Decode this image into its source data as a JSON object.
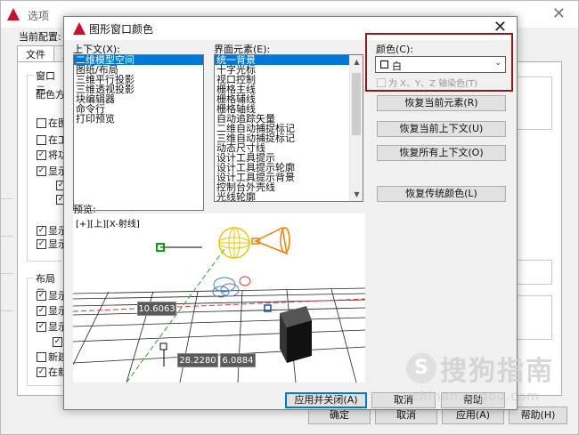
{
  "background_window": {
    "title": "选项",
    "current_profile_label": "当前配置:",
    "tabs": [
      "文件",
      "显"
    ],
    "group1_label": "窗口元",
    "color_scheme_label": "配色方",
    "checkboxes_a": [
      {
        "label": "在图",
        "checked": false
      },
      {
        "label": "在工",
        "checked": false
      },
      {
        "label": "将功",
        "checked": true
      },
      {
        "label": "显示",
        "checked": true
      }
    ],
    "checkboxes_a_sub": [
      {
        "checked": true
      },
      {
        "checked": true
      }
    ],
    "checkboxes_b": [
      {
        "label": "显示",
        "checked": true
      },
      {
        "label": "显示",
        "checked": true
      }
    ],
    "group2_label": "布局元",
    "checkboxes_c": [
      {
        "label": "显示",
        "checked": true
      },
      {
        "label": "显示",
        "checked": true
      },
      {
        "label": "显示",
        "checked": true
      }
    ],
    "checkboxes_c_sub": [
      {
        "checked": true
      }
    ],
    "checkboxes_d": [
      {
        "label": "新建",
        "checked": false
      },
      {
        "label": "在新",
        "checked": true
      }
    ],
    "footer_buttons": [
      "确定",
      "取消",
      "应用(A)",
      "帮助(H)"
    ]
  },
  "dialog": {
    "title": "图形窗口颜色",
    "context_label": "上下文(X):",
    "context_items": [
      "二维模型空间",
      "图纸/布局",
      "三维平行投影",
      "三维透视投影",
      "块编辑器",
      "命令行",
      "打印预览"
    ],
    "context_selected": 0,
    "element_label": "界面元素(E):",
    "element_items": [
      "统一背景",
      "十字光标",
      "视口控制",
      "栅格主线",
      "栅格辅线",
      "栅格轴线",
      "自动追踪矢量",
      "二维自动捕捉标记",
      "三维自动捕捉标记",
      "动态尺寸线",
      "设计工具提示",
      "设计工具提示轮廓",
      "设计工具提示背景",
      "控制台外壳线",
      "光线轮廓"
    ],
    "element_selected": 0,
    "color_label": "颜色(C):",
    "color_value": "白",
    "tint_label": "为 X、Y、Z 轴染色(T)",
    "tint_checked": false,
    "buttons": {
      "restore_element": "恢复当前元素(R)",
      "restore_context": "恢复当前上下文(U)",
      "restore_all": "恢复所有上下文(O)",
      "restore_classic": "恢复传统颜色(L)"
    },
    "preview_label": "预览:",
    "preview": {
      "view_label": "[+][上][X-射线]",
      "dimensions": [
        "10.6063",
        "28.2280",
        "6.0884"
      ]
    },
    "footer": {
      "apply_close": "应用并关闭(A)",
      "cancel": "取消",
      "help": "帮助"
    }
  },
  "watermark": {
    "logo_glyph": "S",
    "text": "搜狗指南",
    "url": "zhinan.sogou.com"
  },
  "colors": {
    "accent": "#0078d7",
    "highlight_border": "#8b1a1a",
    "title_icon": "#c8102e"
  }
}
